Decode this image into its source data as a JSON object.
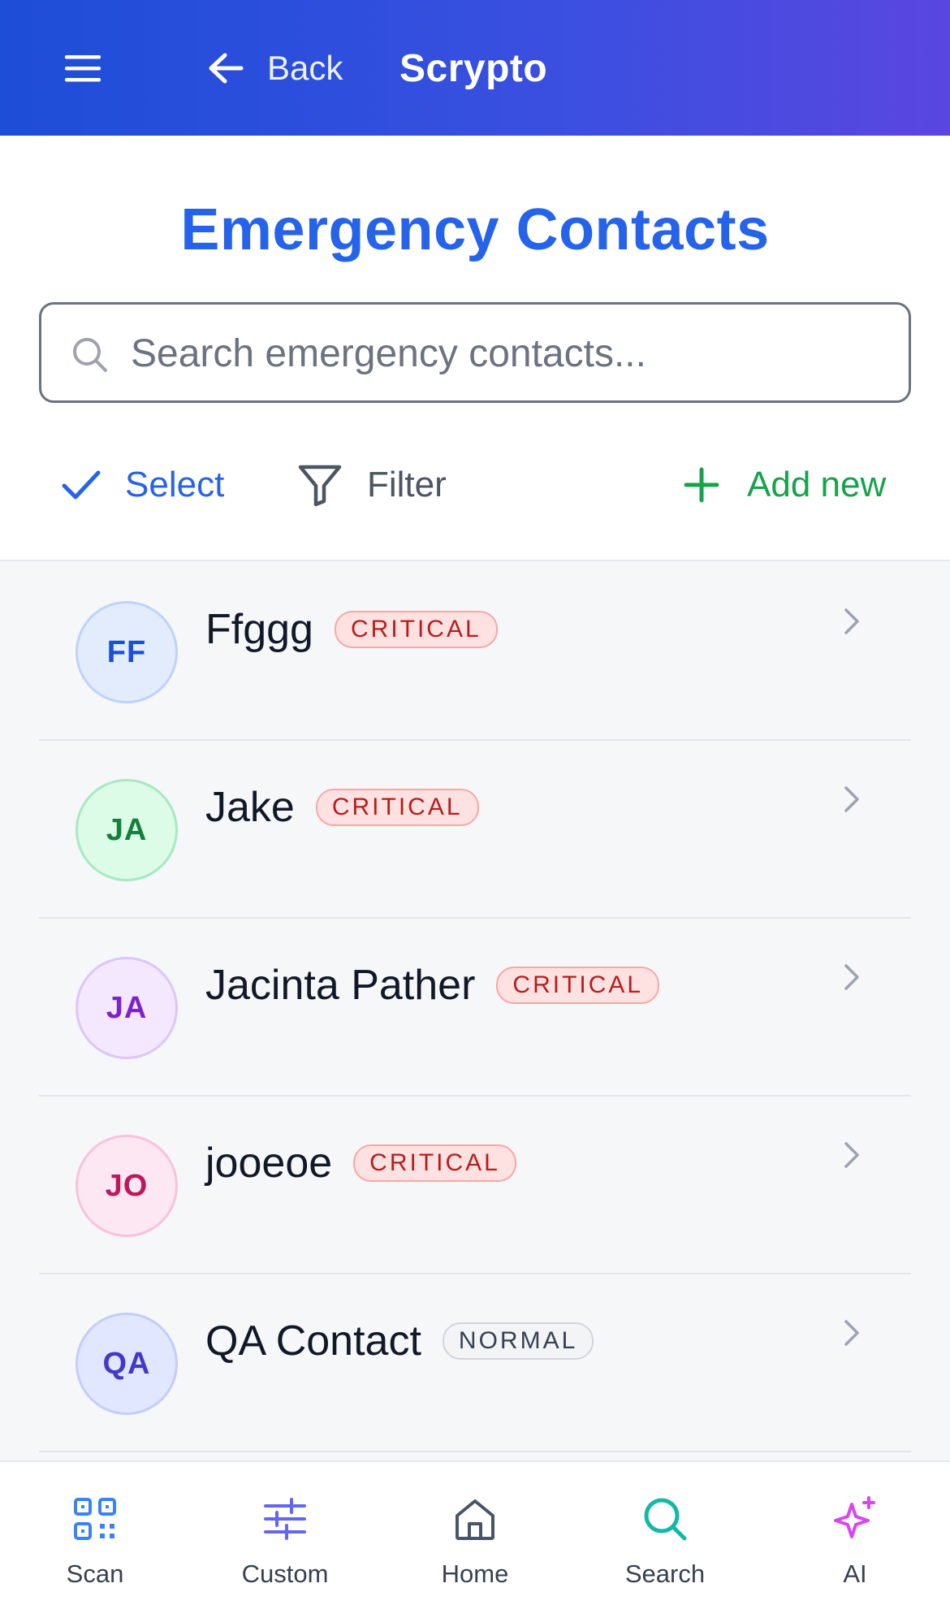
{
  "header": {
    "back_label": "Back",
    "app_title": "Scrypto"
  },
  "page": {
    "title": "Emergency Contacts"
  },
  "search": {
    "value": "",
    "placeholder": "Search emergency contacts..."
  },
  "actions": {
    "select_label": "Select",
    "filter_label": "Filter",
    "add_label": "Add new"
  },
  "contacts": [
    {
      "initials": "FF",
      "name": "Ffggg",
      "priority": "CRITICAL"
    },
    {
      "initials": "JA",
      "name": "Jake",
      "priority": "CRITICAL"
    },
    {
      "initials": "JA",
      "name": "Jacinta Pather",
      "priority": "CRITICAL"
    },
    {
      "initials": "JO",
      "name": "jooeoe",
      "priority": "CRITICAL"
    },
    {
      "initials": "QA",
      "name": "QA Contact",
      "priority": "NORMAL"
    }
  ],
  "bottom_nav": [
    {
      "label": "Scan",
      "icon": "qr-code-icon"
    },
    {
      "label": "Custom",
      "icon": "sliders-icon"
    },
    {
      "label": "Home",
      "icon": "home-icon"
    },
    {
      "label": "Search",
      "icon": "search-icon"
    },
    {
      "label": "AI",
      "icon": "sparkle-icon"
    }
  ],
  "colors": {
    "header_gradient_start": "#1d4ed8",
    "header_gradient_end": "#5a46e0",
    "title_blue": "#2563eb",
    "add_green": "#16a34a",
    "critical_red": "#b91c1c"
  }
}
